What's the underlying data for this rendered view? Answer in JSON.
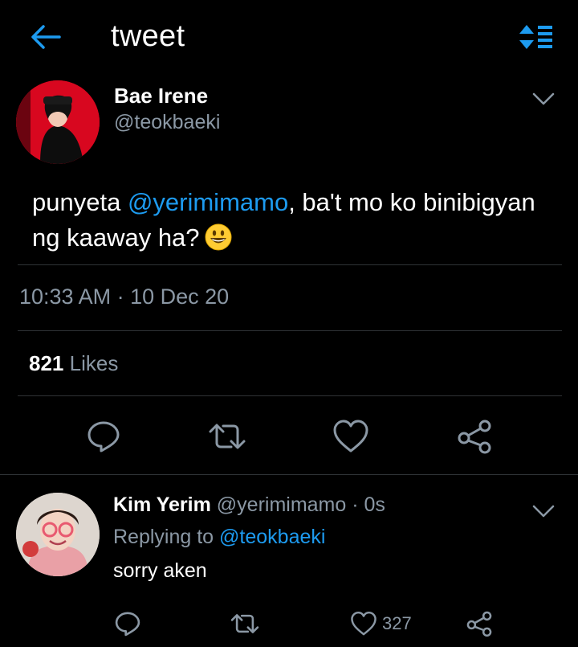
{
  "header": {
    "title": "tweet",
    "back_icon": "arrow-left-icon",
    "sort_icon": "sort-list-icon",
    "accent": "#1d9bf0"
  },
  "tweet": {
    "author_name": "Bae Irene",
    "author_handle": "@teokbaeki",
    "text_before": "punyeta ",
    "mention": "@yerimimamo",
    "text_after": ", ba't mo ko binibigyan ng kaaway ha?",
    "emoji": "grinning-face-icon",
    "time": "10:33 AM",
    "separator": "·",
    "date": "10 Dec 20",
    "likes_count": "821",
    "likes_label": "Likes"
  },
  "reply": {
    "author_name": "Kim Yerim",
    "author_handle": "@yerimimamo",
    "time": "· 0s",
    "replying_label": "Replying to",
    "replying_to": "@teokbaeki",
    "text": "sorry aken",
    "like_count": "327"
  }
}
